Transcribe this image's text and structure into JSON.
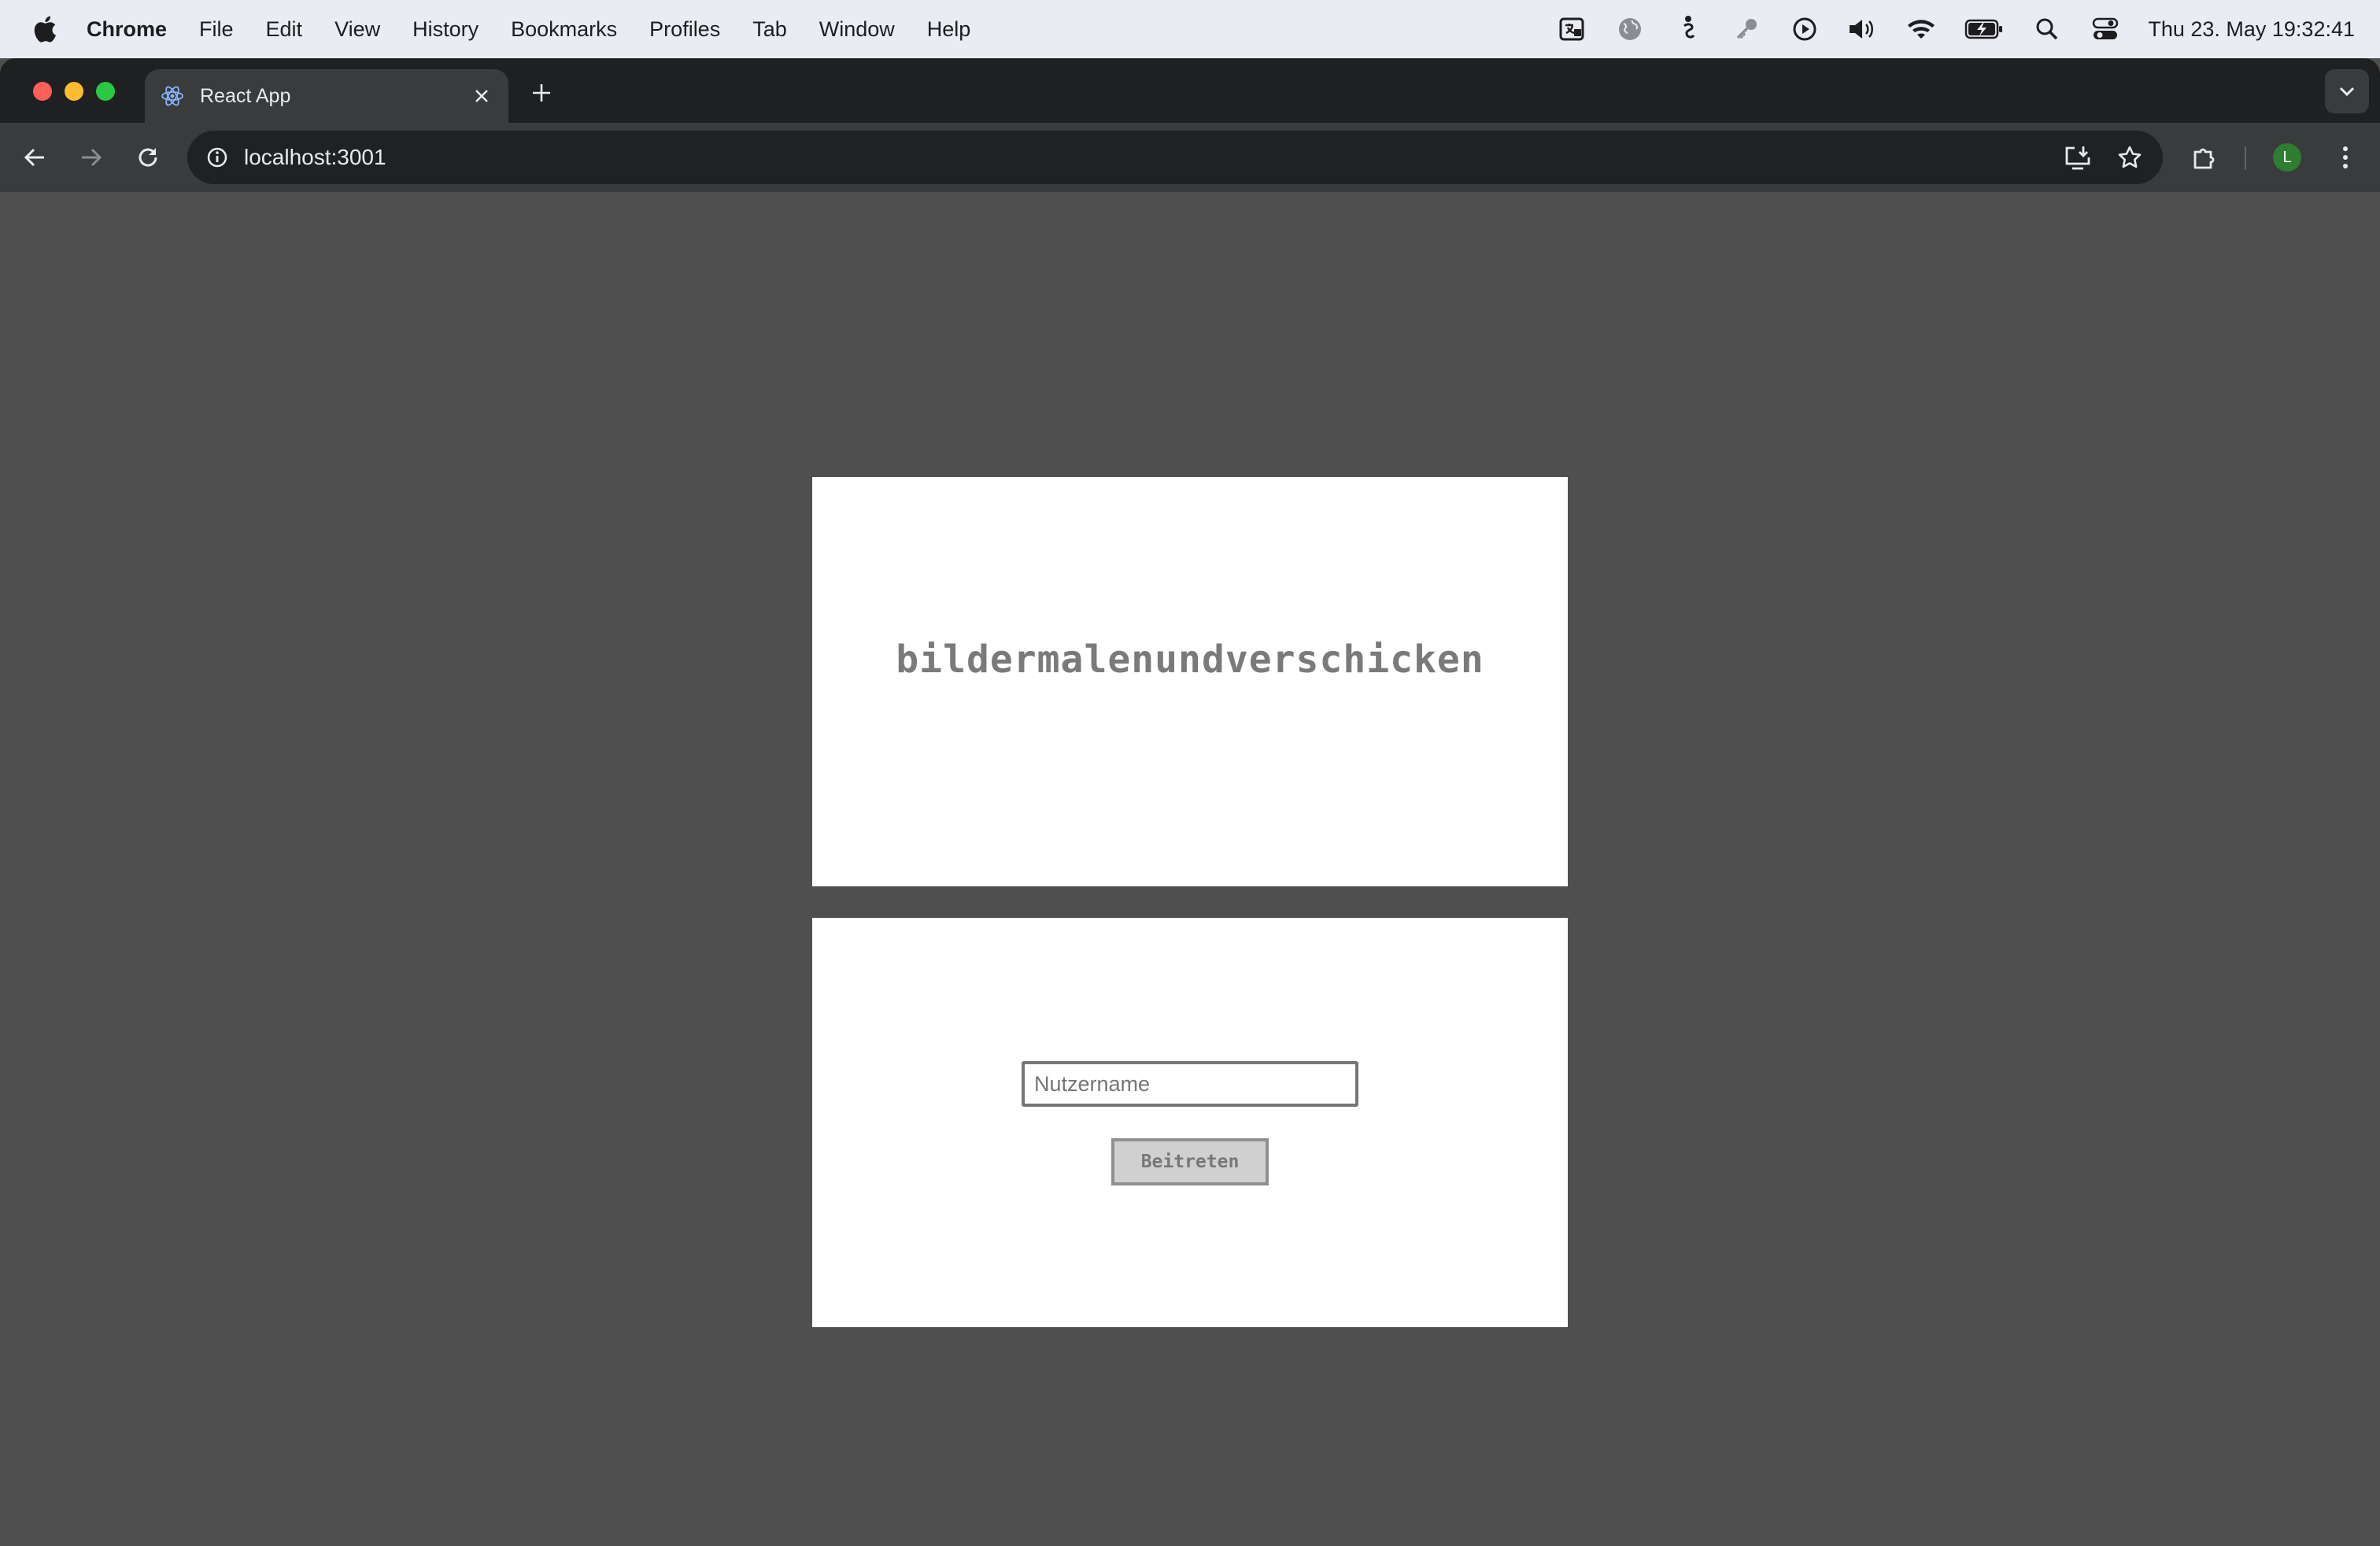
{
  "menubar": {
    "app_name": "Chrome",
    "items": [
      "File",
      "Edit",
      "View",
      "History",
      "Bookmarks",
      "Profiles",
      "Tab",
      "Window",
      "Help"
    ],
    "clock": "Thu 23. May  19:32:41"
  },
  "browser": {
    "tab_title": "React App",
    "url": "localhost:3001",
    "profile_initial": "L"
  },
  "page": {
    "title": "bildermalenundverschicken",
    "username_placeholder": "Nutzername",
    "username_value": "",
    "join_label": "Beitreten"
  },
  "colors": {
    "page_background": "#4f4f4f",
    "panel_background": "#ffffff",
    "title_text": "#7a7a7a",
    "button_background": "#d0d0d0",
    "avatar": "#2e7d32"
  }
}
